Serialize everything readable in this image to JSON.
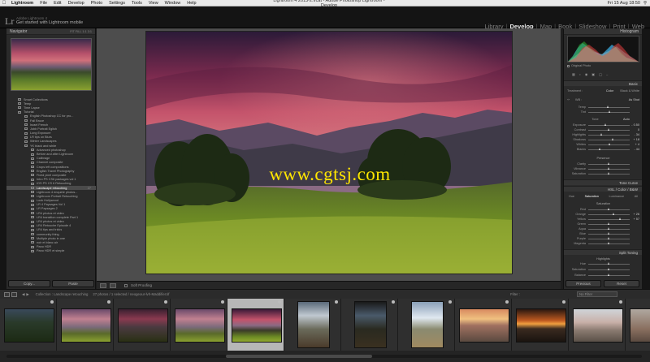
{
  "menubar": {
    "app": "Lightroom",
    "items": [
      "File",
      "Edit",
      "Develop",
      "Photo",
      "Settings",
      "Tools",
      "View",
      "Window",
      "Help"
    ],
    "window_title": "Lightroom 4 2013-2.lrcat - Adobe Photoshop Lightroom - Develop",
    "clock": "Fri 15 Aug  18:50"
  },
  "identity_plate": {
    "logo": "Lr",
    "user": "Adobe Lightroom 4",
    "message": "Get started with Lightroom mobile"
  },
  "modules": [
    "Library",
    "Develop",
    "Map",
    "Book",
    "Slideshow",
    "Print",
    "Web"
  ],
  "active_module": "Develop",
  "left_panel": {
    "navigator_title": "Navigator",
    "navigator_zoom": "FIT  FILL  1:1  3:1",
    "tree": [
      {
        "label": "Smart Collections",
        "count": "",
        "level": 1
      },
      {
        "label": "Temp",
        "count": "",
        "level": 1
      },
      {
        "label": "Time Lapse",
        "count": "",
        "level": 1
      },
      {
        "label": "Tutorial",
        "count": "",
        "level": 1
      },
      {
        "label": "English Photoshop CC for pro...",
        "count": "",
        "level": 2
      },
      {
        "label": "Fall Bruce",
        "count": "",
        "level": 2
      },
      {
        "label": "Israel French",
        "count": "",
        "level": 2
      },
      {
        "label": "Jobb Portrait Eglish",
        "count": "",
        "level": 2
      },
      {
        "label": "Long Exposure",
        "count": "",
        "level": 2
      },
      {
        "label": "LR tips on Blurs",
        "count": "",
        "level": 2
      },
      {
        "label": "Winter Landscapes",
        "count": "",
        "level": 2
      },
      {
        "label": "YK black and white",
        "count": "",
        "level": 2
      },
      {
        "label": "Advanced photoshop",
        "count": "",
        "level": 3
      },
      {
        "label": "Before and after Lightroom",
        "count": "",
        "level": 3
      },
      {
        "label": "Calibrage",
        "count": "",
        "level": 3
      },
      {
        "label": "Channel composite",
        "count": "",
        "level": 3
      },
      {
        "label": "Crops left compositions",
        "count": "",
        "level": 3
      },
      {
        "label": "English Travel Photography",
        "count": "",
        "level": 3
      },
      {
        "label": "Fixed pixel composite",
        "count": "",
        "level": 3
      },
      {
        "label": "Intro PS CS6 packages vol 1",
        "count": "",
        "level": 3
      },
      {
        "label": "IOS PS CS 6 Retouching",
        "count": "",
        "level": 3
      },
      {
        "label": "Landscape retouching",
        "count": "27",
        "level": 3,
        "selected": true
      },
      {
        "label": "Lightroom 4 enquete photos...",
        "count": "",
        "level": 3
      },
      {
        "label": "Lightroom Portrait Retouching",
        "count": "",
        "level": 3
      },
      {
        "label": "Look Hollywood",
        "count": "",
        "level": 3
      },
      {
        "label": "LR 4 Paysages Vol 1",
        "count": "",
        "level": 3
      },
      {
        "label": "LR Paysages 2",
        "count": "",
        "level": 3
      },
      {
        "label": "LR4 photos et video",
        "count": "",
        "level": 3
      },
      {
        "label": "LR4 transition complete Part 1",
        "count": "",
        "level": 3
      },
      {
        "label": "LR4 photos et video",
        "count": "",
        "level": 3
      },
      {
        "label": "LR4 Retouche Episode 4",
        "count": "",
        "level": 3
      },
      {
        "label": "LR4 tips and tricks",
        "count": "",
        "level": 3
      },
      {
        "label": "community thing",
        "count": "",
        "level": 3
      },
      {
        "label": "Multiple photo in one",
        "count": "",
        "level": 3
      },
      {
        "label": "noir et blanc air",
        "count": "",
        "level": 3
      },
      {
        "label": "Pano HDR",
        "count": "",
        "level": 3
      },
      {
        "label": "Pano HDR et simple",
        "count": "",
        "level": 3
      }
    ],
    "copy_button": "Copy...",
    "paste_button": "Paste"
  },
  "center": {
    "watermark": "www.cgtsj.com",
    "toolbar_label": "Soft Proofing"
  },
  "right_panel": {
    "histogram_title": "Histogram",
    "original_photo": "Original Photo",
    "basic_title": "Basic",
    "treatment_label": "Treatment :",
    "treatment_color": "Color",
    "treatment_bw": "Black & White",
    "wb_label": "WB :",
    "wb_value": "As Shot",
    "wb_sliders": [
      {
        "label": "Temp",
        "val": "",
        "pos": 0.48
      },
      {
        "label": "Tint",
        "val": "",
        "pos": 0.52
      }
    ],
    "tone_label": "Tone",
    "tone_auto": "Auto",
    "tone_sliders": [
      {
        "label": "Exposure",
        "val": "- 0.50",
        "pos": 0.42
      },
      {
        "label": "Contrast",
        "val": "0",
        "pos": 0.5
      },
      {
        "label": "Highlights",
        "val": "- 34",
        "pos": 0.33
      },
      {
        "label": "Shadows",
        "val": "+ 18",
        "pos": 0.59
      },
      {
        "label": "Whites",
        "val": "+ 4",
        "pos": 0.52
      },
      {
        "label": "Blacks",
        "val": "- 44",
        "pos": 0.28
      }
    ],
    "presence_label": "Presence",
    "presence_sliders": [
      {
        "label": "Clarity",
        "val": "",
        "pos": 0.5
      },
      {
        "label": "Vibrance",
        "val": "",
        "pos": 0.5
      },
      {
        "label": "Saturation",
        "val": "",
        "pos": 0.5
      }
    ],
    "tone_curve_title": "Tone Curve",
    "hsl_title": "HSL / Color / B&W",
    "hsl_tabs": [
      "Hue",
      "Saturation",
      "Luminance",
      "All"
    ],
    "saturation_label": "Saturation",
    "hsl_sliders": [
      {
        "label": "Red",
        "val": "",
        "pos": 0.5
      },
      {
        "label": "Orange",
        "val": "+ 26",
        "pos": 0.62
      },
      {
        "label": "Yellow",
        "val": "+ 57",
        "pos": 0.78
      },
      {
        "label": "Green",
        "val": "",
        "pos": 0.5
      },
      {
        "label": "Aqua",
        "val": "",
        "pos": 0.5
      },
      {
        "label": "Blue",
        "val": "",
        "pos": 0.5
      },
      {
        "label": "Purple",
        "val": "",
        "pos": 0.5
      },
      {
        "label": "Magenta",
        "val": "",
        "pos": 0.5
      }
    ],
    "split_toning_title": "Split Toning",
    "highlights_label": "Highlights",
    "split_sliders": [
      {
        "label": "Hue",
        "val": "",
        "pos": 0.5
      },
      {
        "label": "Saturation",
        "val": "",
        "pos": 0.5
      },
      {
        "label": "Balance",
        "val": "",
        "pos": 0.5
      }
    ],
    "previous_button": "Previous",
    "reset_button": "Reset"
  },
  "filmstrip": {
    "collection": "Collection : Landscape retouching",
    "count_info": "27 photos / 1 selected / neogeour-lvh-Maddifier.tif",
    "filter_label": "Filter :",
    "filter_value": "No Filter",
    "thumbs": [
      {
        "style": "forest",
        "selected": false
      },
      {
        "style": "pinkfield",
        "selected": false
      },
      {
        "style": "pinkdark",
        "selected": false
      },
      {
        "style": "pinkfield",
        "selected": false
      },
      {
        "style": "pinkmain",
        "selected": true
      },
      {
        "style": "roadcloud",
        "selected": false
      },
      {
        "style": "roaddark",
        "selected": false
      },
      {
        "style": "roadbright",
        "selected": false
      },
      {
        "style": "sunsetland",
        "selected": false
      },
      {
        "style": "sunsetdark",
        "selected": false
      },
      {
        "style": "hazyland",
        "selected": false
      },
      {
        "style": "edge",
        "selected": false
      }
    ]
  }
}
